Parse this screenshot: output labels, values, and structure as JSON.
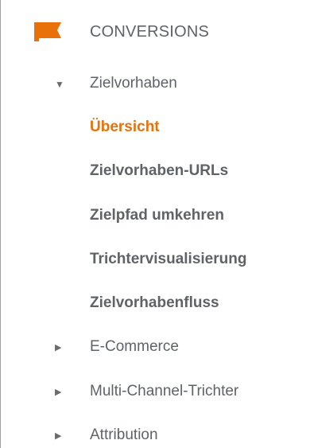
{
  "colors": {
    "accent": "#e8710a",
    "text": "#5f6368",
    "arrow": "#6b6b6b"
  },
  "header": {
    "icon": "flag-icon",
    "label": "CONVERSIONS"
  },
  "nav": {
    "goals": {
      "label": "Zielvorhaben",
      "expanded": true,
      "children": [
        {
          "label": "Übersicht",
          "active": true
        },
        {
          "label": "Zielvorhaben-URLs",
          "active": false
        },
        {
          "label": "Zielpfad umkehren",
          "active": false
        },
        {
          "label": "Trichtervisualisierung",
          "active": false
        },
        {
          "label": "Zielvorhabenfluss",
          "active": false
        }
      ]
    },
    "ecommerce": {
      "label": "E-Commerce",
      "expanded": false
    },
    "multichannel": {
      "label": "Multi-Channel-Trichter",
      "expanded": false
    },
    "attribution": {
      "label": "Attribution",
      "expanded": false
    }
  }
}
